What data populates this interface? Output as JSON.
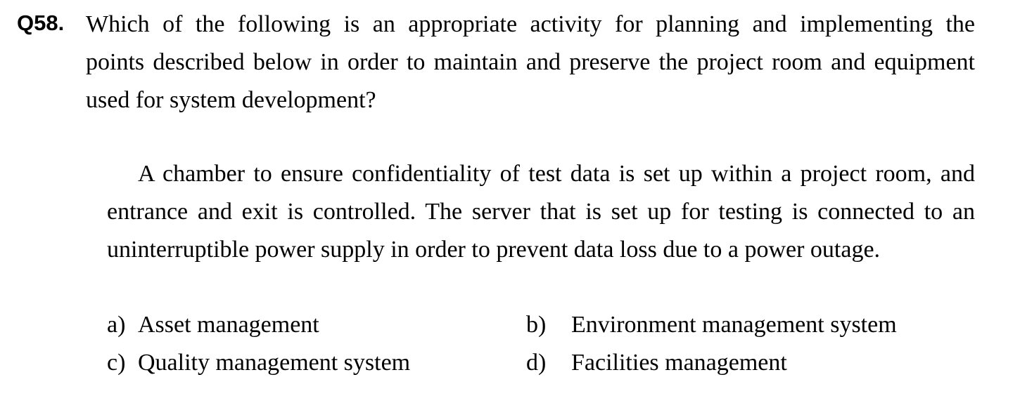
{
  "question": {
    "number": "Q58.",
    "lines": [
      "Which of the following is an appropriate activity for planning and implementing the",
      "points described below in order to maintain and preserve the project room and equipment",
      "used for system development?"
    ]
  },
  "passage": {
    "lines": [
      "A chamber to ensure confidentiality of test data is set up within a project room, and",
      "entrance and exit is controlled. The server that is set up for testing is connected to an",
      "uninterruptible power supply in order to prevent data loss due to a power outage."
    ]
  },
  "options": [
    {
      "letter": "a)",
      "text": "Asset management"
    },
    {
      "letter": "b)",
      "text": "Environment management system"
    },
    {
      "letter": "c)",
      "text": "Quality management system"
    },
    {
      "letter": "d)",
      "text": "Facilities management"
    }
  ]
}
